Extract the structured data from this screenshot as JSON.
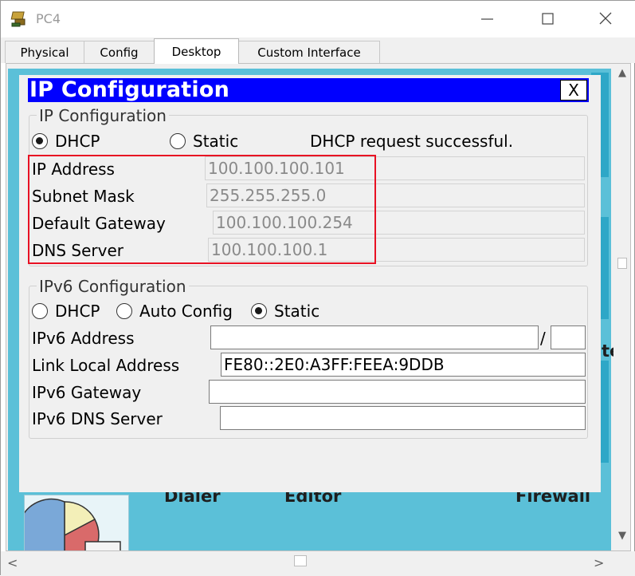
{
  "window": {
    "title": "PC4",
    "minimize_glyph": "—",
    "maximize_glyph": "☐",
    "close_glyph": "✕"
  },
  "tabs": [
    {
      "label": "Physical",
      "active": false
    },
    {
      "label": "Config",
      "active": false
    },
    {
      "label": "Desktop",
      "active": true
    },
    {
      "label": "Custom Interface",
      "active": false
    }
  ],
  "background_apps": {
    "dialer_label": "Dialer",
    "editor_label": "Editor",
    "firewall_label": "Firewall",
    "partial_label": "te"
  },
  "ip_config": {
    "dialog_title": "IP Configuration",
    "close_label": "X",
    "ipv4": {
      "group_title": "IP Configuration",
      "dhcp_label": "DHCP",
      "static_label": "Static",
      "mode": "DHCP",
      "status_text": "DHCP request successful.",
      "ip_address_label": "IP Address",
      "ip_address": "100.100.100.101",
      "subnet_mask_label": "Subnet Mask",
      "subnet_mask": "255.255.255.0",
      "default_gateway_label": "Default Gateway",
      "default_gateway": "100.100.100.254",
      "dns_server_label": "DNS Server",
      "dns_server": "100.100.100.1"
    },
    "ipv6": {
      "group_title": "IPv6 Configuration",
      "dhcp_label": "DHCP",
      "auto_config_label": "Auto Config",
      "static_label": "Static",
      "mode": "Static",
      "ipv6_address_label": "IPv6 Address",
      "ipv6_address": "",
      "prefix_separator": "/",
      "prefix_length": "",
      "link_local_label": "Link Local Address",
      "link_local_address": "FE80::2E0:A3FF:FEEA:9DDB",
      "ipv6_gateway_label": "IPv6 Gateway",
      "ipv6_gateway": "",
      "ipv6_dns_label": "IPv6 DNS Server",
      "ipv6_dns": ""
    }
  },
  "scroll": {
    "up_glyph": "▲",
    "down_glyph": "▼",
    "left_glyph": "<",
    "right_glyph": ">"
  },
  "colors": {
    "dialog_header": "#0000ff",
    "desktop_bg": "#5bc0d8",
    "highlight": "#e81123"
  }
}
